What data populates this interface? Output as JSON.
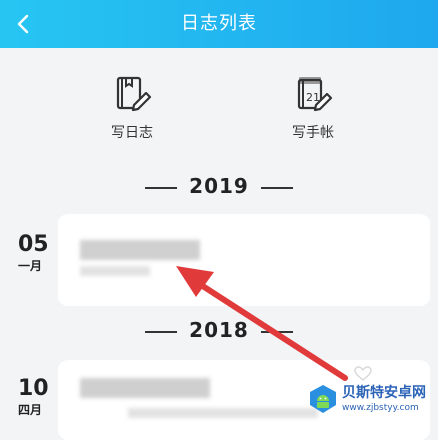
{
  "header": {
    "title": "日志列表",
    "back_icon": "chevron-left-icon"
  },
  "actions": [
    {
      "label": "写日志",
      "icon": "diary-pen-icon"
    },
    {
      "label": "写手帐",
      "icon": "notebook-pen-icon"
    }
  ],
  "groups": [
    {
      "year": "2019",
      "entries": [
        {
          "day": "05",
          "month": "一月"
        }
      ]
    },
    {
      "year": "2018",
      "entries": [
        {
          "day": "10",
          "month": "四月"
        }
      ]
    }
  ],
  "watermark": {
    "name": "贝斯特安卓网",
    "url": "www.zjbstyy.com"
  },
  "colors": {
    "header_start": "#27c6f2",
    "header_end": "#1ea7ee",
    "arrow": "#e03a3a",
    "background": "#f3f4f6"
  }
}
